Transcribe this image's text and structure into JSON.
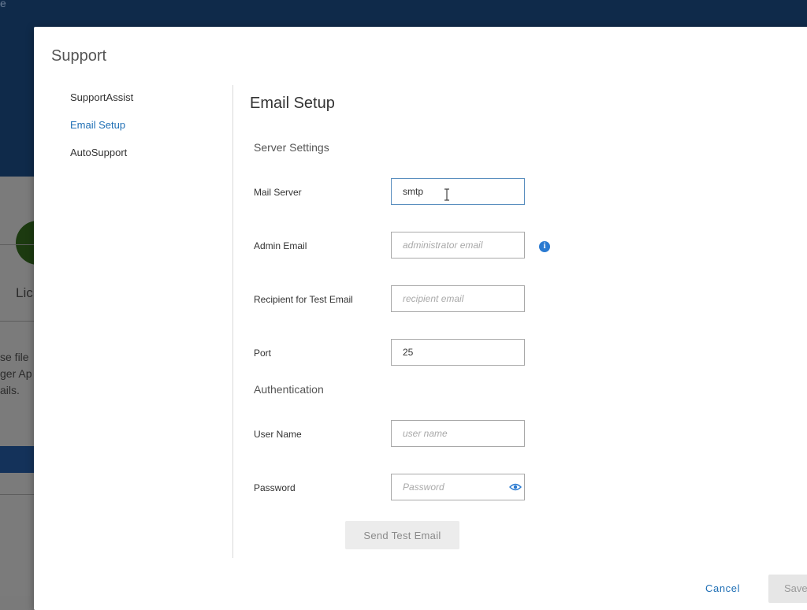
{
  "background": {
    "top_char": "e",
    "fragments": [
      "Lic",
      "se file",
      "ger Ap",
      "ails."
    ]
  },
  "modal": {
    "title": "Support",
    "nav": [
      {
        "label": "SupportAssist",
        "active": false
      },
      {
        "label": "Email Setup",
        "active": true
      },
      {
        "label": "AutoSupport",
        "active": false
      }
    ],
    "section_title": "Email Setup",
    "server_settings": {
      "heading": "Server Settings",
      "mail_server": {
        "label": "Mail Server",
        "value": "smtp"
      },
      "admin_email": {
        "label": "Admin Email",
        "placeholder": "administrator email"
      },
      "recipient": {
        "label": "Recipient for Test Email",
        "placeholder": "recipient email"
      },
      "port": {
        "label": "Port",
        "value": "25"
      }
    },
    "authentication": {
      "heading": "Authentication",
      "user_name": {
        "label": "User Name",
        "placeholder": "user name"
      },
      "password": {
        "label": "Password",
        "placeholder": "Password"
      }
    },
    "info_icon": "i",
    "send_test_label": "Send Test Email",
    "cancel_label": "Cancel",
    "save_label": "Save"
  },
  "colors": {
    "accent": "#1f6fb5",
    "info": "#2a7ad1",
    "header_bg": "#0f2a4a"
  },
  "icons": [
    "info-icon",
    "eye-icon",
    "text-cursor-icon"
  ]
}
